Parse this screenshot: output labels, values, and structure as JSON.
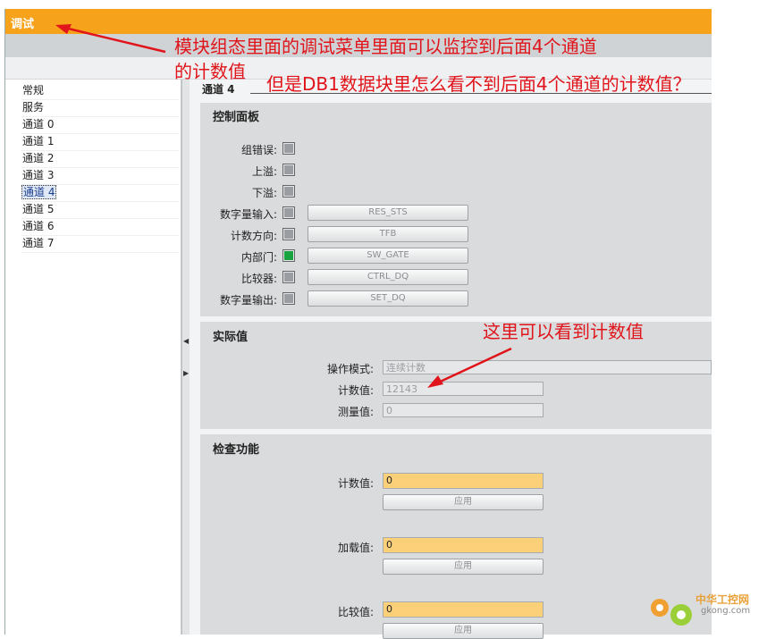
{
  "window": {
    "title": "调试"
  },
  "nav": {
    "items": [
      {
        "label": "常规",
        "selected": false
      },
      {
        "label": "服务",
        "selected": false
      },
      {
        "label": "通道 0",
        "selected": false
      },
      {
        "label": "通道 1",
        "selected": false
      },
      {
        "label": "通道 2",
        "selected": false
      },
      {
        "label": "通道 3",
        "selected": false
      },
      {
        "label": "通道 4",
        "selected": true
      },
      {
        "label": "通道 5",
        "selected": false
      },
      {
        "label": "通道 6",
        "selected": false
      },
      {
        "label": "通道 7",
        "selected": false
      }
    ]
  },
  "channel": {
    "title": "通道 4"
  },
  "control_panel": {
    "title": "控制面板",
    "rows": [
      {
        "label": "组错误:",
        "state": "off",
        "button": ""
      },
      {
        "label": "上溢:",
        "state": "off",
        "button": ""
      },
      {
        "label": "下溢:",
        "state": "off",
        "button": ""
      },
      {
        "label": "数字量输入:",
        "state": "off",
        "button": "RES_STS"
      },
      {
        "label": "计数方向:",
        "state": "off",
        "button": "TFB"
      },
      {
        "label": "内部门:",
        "state": "on",
        "button": "SW_GATE"
      },
      {
        "label": "比较器:",
        "state": "off",
        "button": "CTRL_DQ"
      },
      {
        "label": "数字量输出:",
        "state": "off",
        "button": "SET_DQ"
      }
    ]
  },
  "actual_values": {
    "title": "实际值",
    "mode_label": "操作模式:",
    "mode_value": "连续计数",
    "count_label": "计数值:",
    "count_value": "12143",
    "measure_label": "测量值:",
    "measure_value": "0"
  },
  "check_function": {
    "title": "检查功能",
    "count_label": "计数值:",
    "count_value": "0",
    "apply1": "应用",
    "load_label": "加载值:",
    "load_value": "0",
    "apply2": "应用",
    "compare_label": "比较值:",
    "compare_value": "0",
    "apply3": "应用"
  },
  "annotations": {
    "line1": "模块组态里面的调试菜单里面可以监控到后面4个通道",
    "line2": "的计数值",
    "question": "但是DB1数据块里怎么看不到后面4个通道的计数值？",
    "count_note": "这里可以看到计数值"
  },
  "watermark": {
    "cn": "中华工控网",
    "en": "gkong.com"
  },
  "colors": {
    "title_bar": "#f7a21b",
    "annotation": "#e0141a",
    "input_bg": "#fcd078",
    "led_on": "#18a340"
  }
}
